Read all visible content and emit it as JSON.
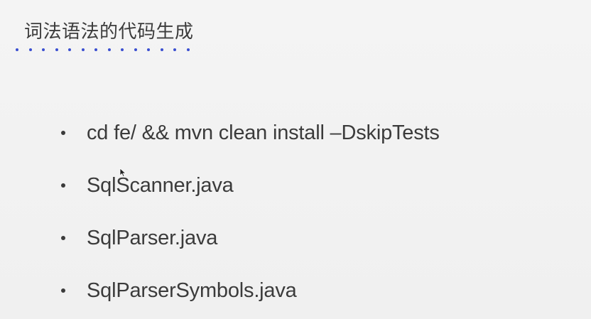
{
  "slide": {
    "title": "词法语法的代码生成",
    "bullets": [
      "cd fe/ && mvn clean install –DskipTests",
      "SqlScanner.java",
      "SqlParser.java",
      "SqlParserSymbols.java"
    ]
  },
  "colors": {
    "background": "#f2f2f2",
    "text": "#3b3b3b",
    "accent_dots": "#3a4fd0"
  },
  "icons": {
    "pointer": "mouse-pointer-icon"
  }
}
